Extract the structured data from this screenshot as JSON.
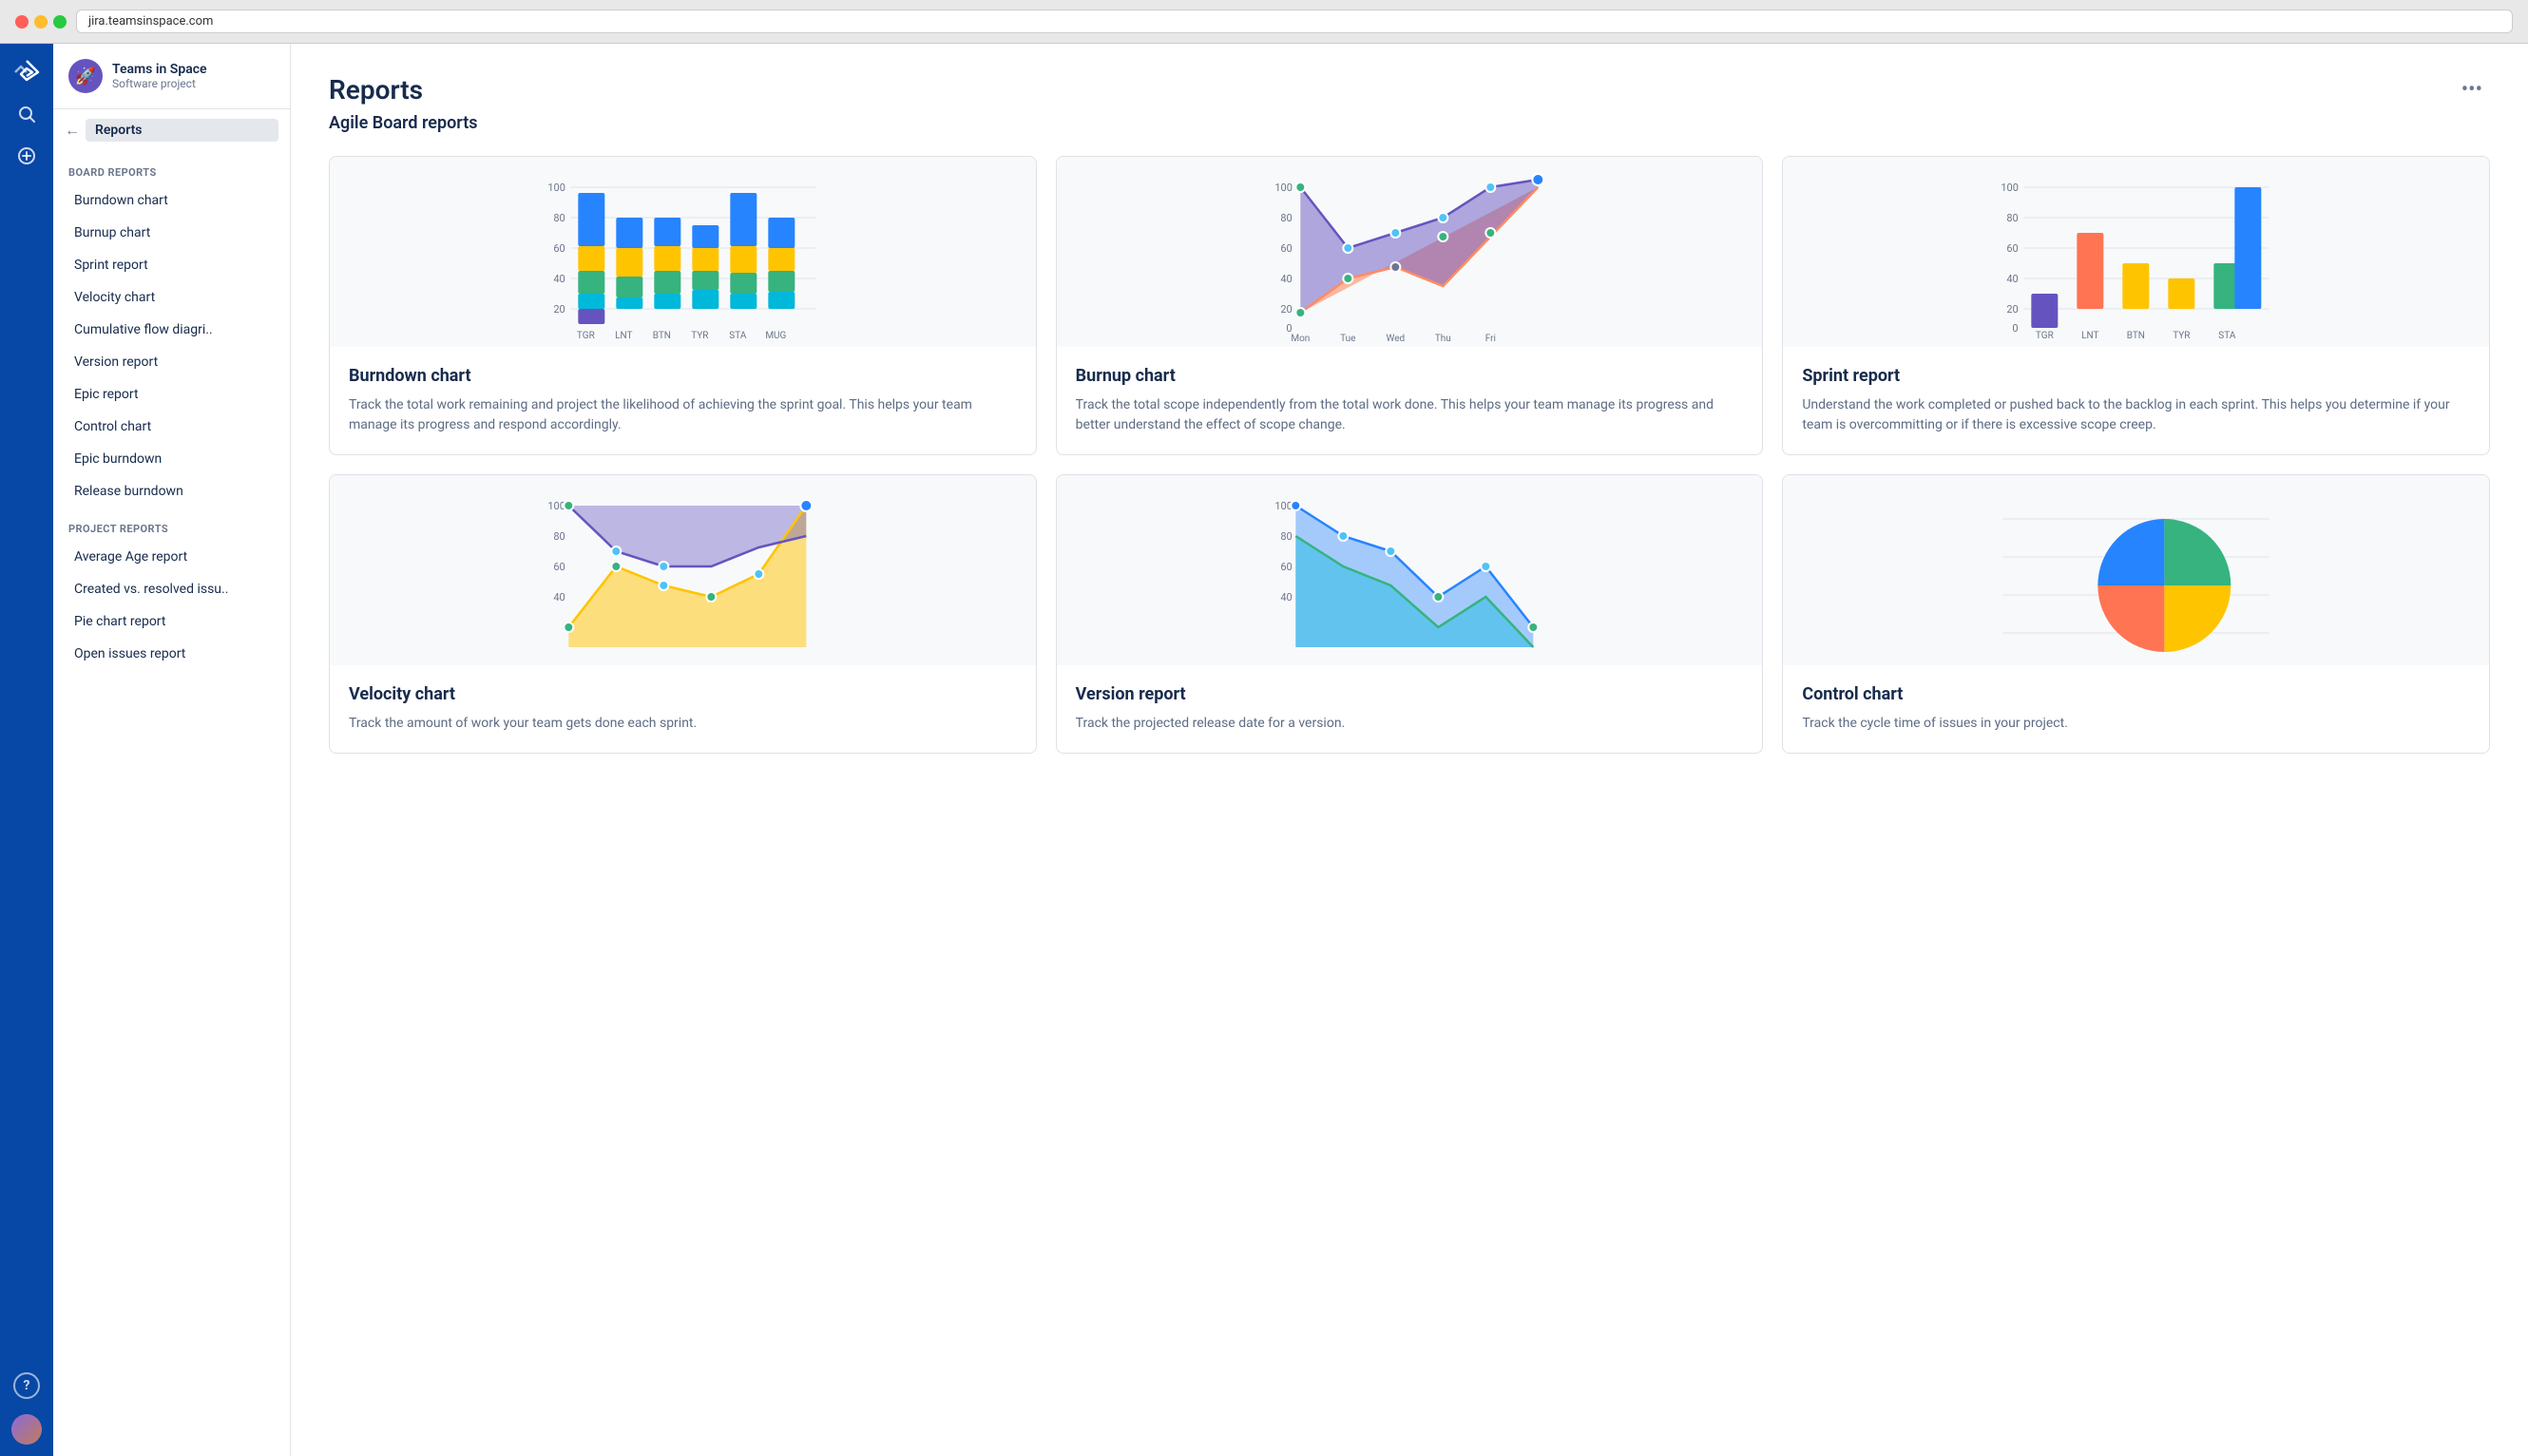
{
  "browser": {
    "url": "jira.teamsinspace.com"
  },
  "sidebar": {
    "project_name": "Teams in Space",
    "project_type": "Software project",
    "back_label": "Reports",
    "board_reports_label": "BOARD REPORTS",
    "project_reports_label": "PROJECT REPORTS",
    "board_items": [
      "Burndown chart",
      "Burnup chart",
      "Sprint report",
      "Velocity chart",
      "Cumulative flow diagri..",
      "Version report",
      "Epic report",
      "Control chart",
      "Epic burndown",
      "Release burndown"
    ],
    "project_items": [
      "Average Age report",
      "Created vs. resolved issu..",
      "Pie chart report",
      "Open issues report"
    ]
  },
  "page": {
    "title": "Reports",
    "section_title": "Agile Board reports",
    "more_icon": "•••"
  },
  "cards": [
    {
      "id": "burndown",
      "title": "Burndown chart",
      "description": "Track the total work remaining and project the likelihood of achieving the sprint goal. This helps your team manage its progress and respond accordingly."
    },
    {
      "id": "burnup",
      "title": "Burnup chart",
      "description": "Track the total scope independently from the total work done. This helps your team manage its progress and better understand the effect of scope change."
    },
    {
      "id": "sprint",
      "title": "Sprint report",
      "description": "Understand the work completed or pushed back to the backlog in each sprint. This helps you determine if your team is overcommitting or if there is excessive scope creep."
    },
    {
      "id": "velocity",
      "title": "Velocity chart",
      "description": "Track the amount of work your team gets done each sprint."
    },
    {
      "id": "version",
      "title": "Version report",
      "description": "Track the projected release date for a version."
    },
    {
      "id": "control",
      "title": "Control chart",
      "description": "Track the cycle time of issues in your project."
    }
  ]
}
